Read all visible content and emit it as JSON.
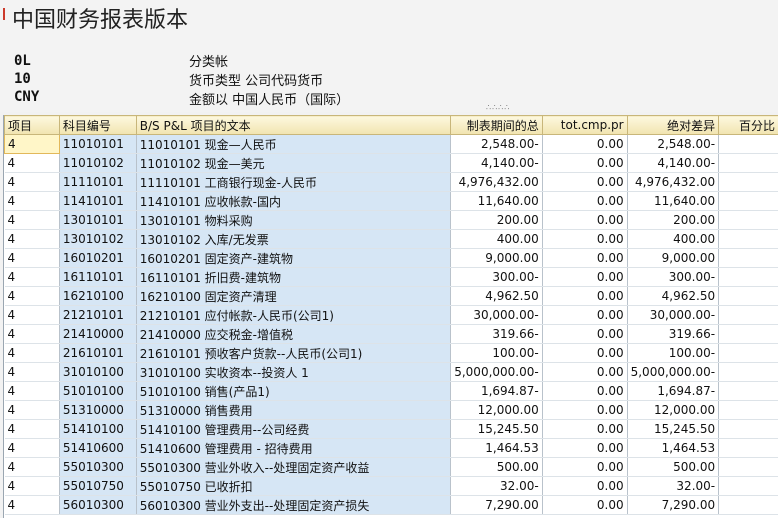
{
  "title": "中国财务报表版本",
  "meta": [
    {
      "code": "0L",
      "label": "分类帐"
    },
    {
      "code": "10",
      "label": "货币类型  公司代码货币"
    },
    {
      "code": "CNY",
      "label": "金额以  中国人民币（国际）"
    }
  ],
  "splitter": "∴∴∴∴",
  "columns": [
    "项目",
    "科目编号",
    "B/S P&L 项目的文本",
    "制表期间的总",
    "tot.cmp.pr",
    "绝对差异",
    "百分比"
  ],
  "rows": [
    [
      "4",
      "11010101",
      "11010101 现金—人民币",
      "2,548.00-",
      "0.00",
      "2,548.00-",
      ""
    ],
    [
      "4",
      "11010102",
      "11010102 现金—美元",
      "4,140.00-",
      "0.00",
      "4,140.00-",
      ""
    ],
    [
      "4",
      "11110101",
      "11110101 工商银行现金-人民币",
      "4,976,432.00",
      "0.00",
      "4,976,432.00",
      ""
    ],
    [
      "4",
      "11410101",
      "11410101 应收帐款-国内",
      "11,640.00",
      "0.00",
      "11,640.00",
      ""
    ],
    [
      "4",
      "13010101",
      "13010101 物料采购",
      "200.00",
      "0.00",
      "200.00",
      ""
    ],
    [
      "4",
      "13010102",
      "13010102 入库/无发票",
      "400.00",
      "0.00",
      "400.00",
      ""
    ],
    [
      "4",
      "16010201",
      "16010201 固定资产-建筑物",
      "9,000.00",
      "0.00",
      "9,000.00",
      ""
    ],
    [
      "4",
      "16110101",
      "16110101 折旧费-建筑物",
      "300.00-",
      "0.00",
      "300.00-",
      ""
    ],
    [
      "4",
      "16210100",
      "16210100 固定资产清理",
      "4,962.50",
      "0.00",
      "4,962.50",
      ""
    ],
    [
      "4",
      "21210101",
      "21210101 应付帐款-人民币(公司1)",
      "30,000.00-",
      "0.00",
      "30,000.00-",
      ""
    ],
    [
      "4",
      "21410000",
      "21410000 应交税金-增值税",
      "319.66-",
      "0.00",
      "319.66-",
      ""
    ],
    [
      "4",
      "21610101",
      "21610101 预收客户货款--人民币(公司1)",
      "100.00-",
      "0.00",
      "100.00-",
      ""
    ],
    [
      "4",
      "31010100",
      "31010100 实收资本--投资人 1",
      "5,000,000.00-",
      "0.00",
      "5,000,000.00-",
      ""
    ],
    [
      "4",
      "51010100",
      "51010100 销售(产品1)",
      "1,694.87-",
      "0.00",
      "1,694.87-",
      ""
    ],
    [
      "4",
      "51310000",
      "51310000 销售费用",
      "12,000.00",
      "0.00",
      "12,000.00",
      ""
    ],
    [
      "4",
      "51410100",
      "51410100 管理费用--公司经费",
      "15,245.50",
      "0.00",
      "15,245.50",
      ""
    ],
    [
      "4",
      "51410600",
      "51410600 管理费用 - 招待费用",
      "1,464.53",
      "0.00",
      "1,464.53",
      ""
    ],
    [
      "4",
      "55010300",
      "55010300 营业外收入--处理固定资产收益",
      "500.00",
      "0.00",
      "500.00",
      ""
    ],
    [
      "4",
      "55010750",
      "55010750 已收折扣",
      "32.00-",
      "0.00",
      "32.00-",
      ""
    ],
    [
      "4",
      "56010300",
      "56010300 营业外支出--处理固定资产损失",
      "7,290.00",
      "0.00",
      "7,290.00",
      ""
    ]
  ]
}
